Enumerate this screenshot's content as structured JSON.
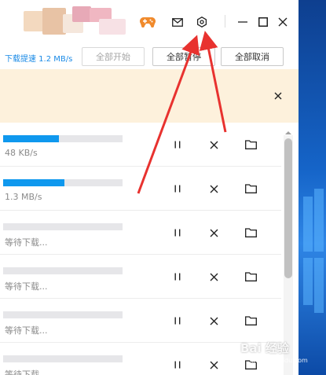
{
  "toolbar": {
    "speed_text": "下载提速 1.2 MB/s",
    "start_all": "全部开始",
    "pause_all": "全部暂停",
    "cancel_all": "全部取消"
  },
  "titlebar": {
    "icons": [
      "game-controller-icon",
      "mail-icon",
      "settings-gear-icon",
      "minimize-icon",
      "maximize-icon",
      "close-icon"
    ]
  },
  "notice": {
    "close_icon": "close-icon"
  },
  "downloads": [
    {
      "status": "48 KB/s",
      "progress": 0.47
    },
    {
      "status": "1.3 MB/s",
      "progress": 0.51
    },
    {
      "status": "等待下载...",
      "progress": 0
    },
    {
      "status": "等待下载...",
      "progress": 0
    },
    {
      "status": "等待下载...",
      "progress": 0
    },
    {
      "status": "等待下载...",
      "progress": 0
    }
  ],
  "row_actions": [
    "pause-icon",
    "cancel-icon",
    "folder-icon"
  ],
  "watermark": {
    "text": "Bai 经验",
    "sub": "jingyan.baidu.com"
  },
  "colors": {
    "accent": "#1a8ae6",
    "progress_fill": "#0f98ee",
    "notice_bg": "#fdf1dc",
    "arrow": "#e8322f",
    "game_icon": "#f08a2c"
  }
}
